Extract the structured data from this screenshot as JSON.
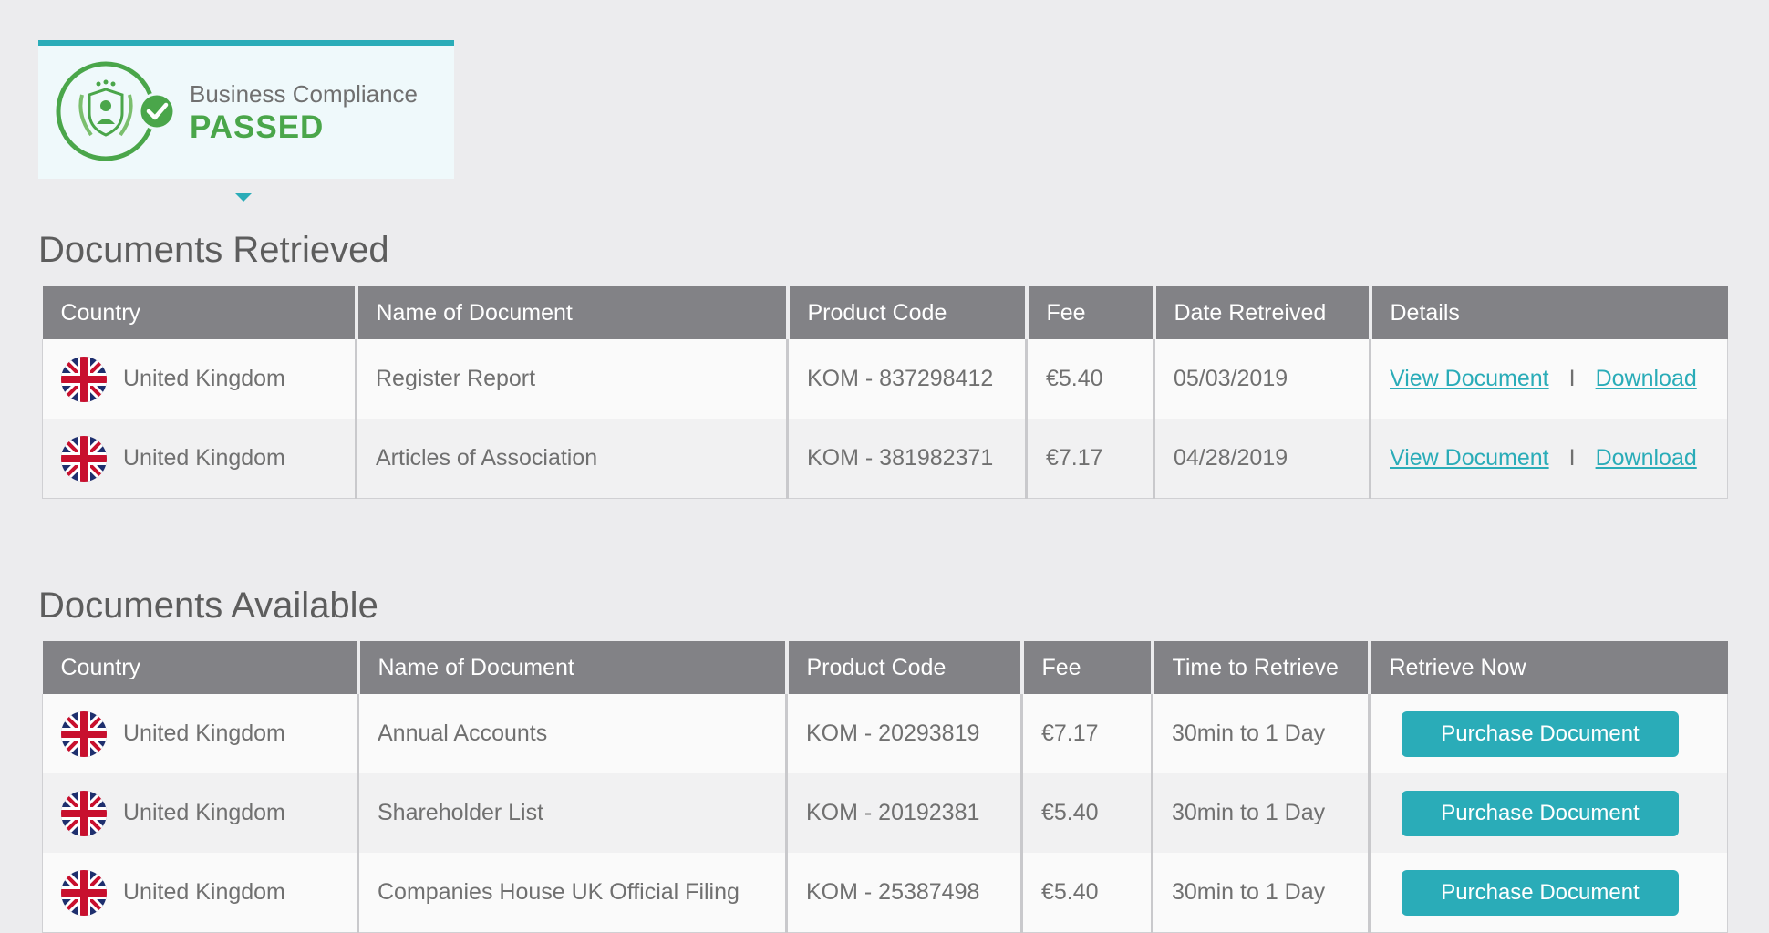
{
  "compliance": {
    "caption": "Business Compliance",
    "status": "PASSED",
    "accent_color": "#2aacb8",
    "status_color": "#4aa64a"
  },
  "retrieved": {
    "title": "Documents Retrieved",
    "headers": [
      "Country",
      "Name of Document",
      "Product Code",
      "Fee",
      "Date Retreived",
      "Details"
    ],
    "rows": [
      {
        "country": "United Kingdom",
        "document": "Register Report",
        "code": "KOM - 837298412",
        "fee": "€5.40",
        "date": "05/03/2019",
        "view": "View Document",
        "sep": "I",
        "download": "Download"
      },
      {
        "country": "United Kingdom",
        "document": "Articles of Association",
        "code": "KOM - 381982371",
        "fee": "€7.17",
        "date": "04/28/2019",
        "view": "View Document",
        "sep": "I",
        "download": "Download"
      }
    ]
  },
  "available": {
    "title": "Documents Available",
    "headers": [
      "Country",
      "Name of Document",
      "Product Code",
      "Fee",
      "Time to Retrieve",
      "Retrieve Now"
    ],
    "rows": [
      {
        "country": "United Kingdom",
        "document": "Annual Accounts",
        "code": "KOM - 20293819",
        "fee": "€7.17",
        "time": "30min to 1 Day",
        "button": "Purchase Document"
      },
      {
        "country": "United Kingdom",
        "document": "Shareholder List",
        "code": "KOM - 20192381",
        "fee": "€5.40",
        "time": "30min to 1 Day",
        "button": "Purchase Document"
      },
      {
        "country": "United Kingdom",
        "document": "Companies House UK Official Filing",
        "code": "KOM - 25387498",
        "fee": "€5.40",
        "time": "30min to 1 Day",
        "button": "Purchase Document"
      }
    ]
  }
}
